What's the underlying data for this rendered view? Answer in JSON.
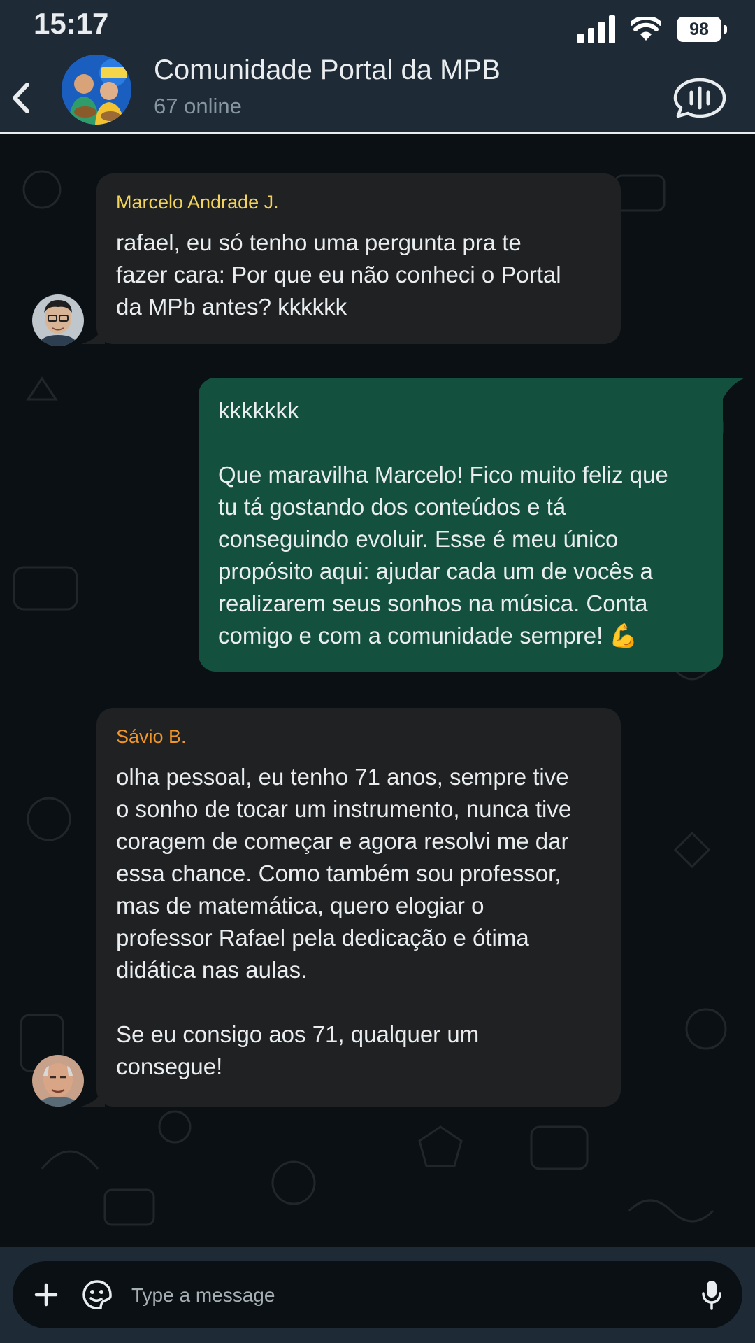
{
  "status_bar": {
    "time": "15:17",
    "battery": "98"
  },
  "header": {
    "title": "Comunidade Portal da MPB",
    "subtitle": "67 online"
  },
  "messages": [
    {
      "direction": "incoming",
      "sender": "Marcelo Andrade J.",
      "sender_color": "#f3d35a",
      "text": "rafael, eu só tenho uma pergunta pra te\nfazer cara: Por que eu não conheci o Portal\nda MPb antes? kkkkkk"
    },
    {
      "direction": "outgoing",
      "text": "kkkkkkk\n\nQue maravilha Marcelo! Fico muito feliz que\ntu tá gostando dos conteúdos e tá\nconseguindo evoluir. Esse é meu único\npropósito aqui: ajudar cada um de vocês a\nrealizarem seus sonhos na música. Conta\ncomigo e com a comunidade sempre!  💪"
    },
    {
      "direction": "incoming",
      "sender": "Sávio B.",
      "sender_color": "#f0962a",
      "text": "olha pessoal, eu tenho 71 anos, sempre tive\no sonho de tocar um instrumento, nunca tive\ncoragem de começar e agora resolvi me dar\nessa chance. Como também sou professor,\nmas de matemática, quero elogiar o\nprofessor Rafael pela dedicação e ótima\ndidática nas aulas.\n\nSe eu consigo aos 71, qualquer um\nconsegue!"
    }
  ],
  "composer": {
    "placeholder": "Type a message"
  },
  "icons": {
    "back": "chevron-left-icon",
    "call": "group-call-icon",
    "attach": "plus-icon",
    "sticker": "sticker-icon",
    "mic": "microphone-icon"
  },
  "colors": {
    "header_bg": "#1e2a35",
    "incoming_bubble": "#1f2123",
    "outgoing_bubble": "#13503d",
    "chat_bg": "#0b1014"
  }
}
